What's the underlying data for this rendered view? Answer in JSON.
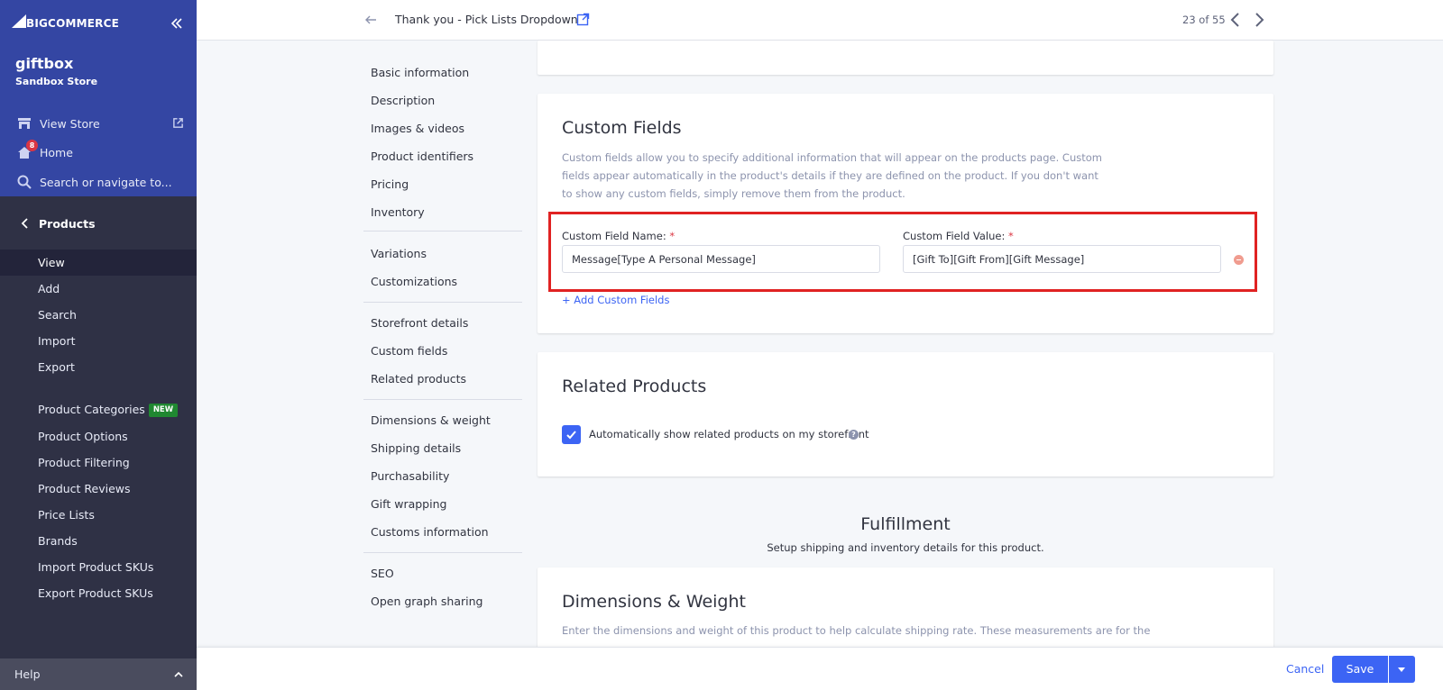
{
  "brand": {
    "logo_text": "BIGCOMMERCE",
    "store_name": "giftbox",
    "store_type": "Sandbox Store"
  },
  "sidebar": {
    "view_store": "View Store",
    "home": "Home",
    "home_badge": "8",
    "search_placeholder": "Search or navigate to...",
    "section": "Products",
    "items": [
      {
        "label": "View",
        "active": true
      },
      {
        "label": "Add"
      },
      {
        "label": "Search"
      },
      {
        "label": "Import"
      },
      {
        "label": "Export"
      }
    ],
    "items2": [
      {
        "label": "Product Categories",
        "badge": "NEW"
      },
      {
        "label": "Product Options"
      },
      {
        "label": "Product Filtering"
      },
      {
        "label": "Product Reviews"
      },
      {
        "label": "Price Lists"
      },
      {
        "label": "Brands"
      },
      {
        "label": "Import Product SKUs"
      },
      {
        "label": "Export Product SKUs"
      }
    ],
    "help": "Help"
  },
  "header": {
    "title": "Thank you - Pick Lists Dropdown",
    "pager": "23 of 55"
  },
  "section_nav": [
    "Basic information",
    "Description",
    "Images & videos",
    "Product identifiers",
    "Pricing",
    "Inventory",
    "Variations",
    "Customizations",
    "Storefront details",
    "Custom fields",
    "Related products",
    "Dimensions & weight",
    "Shipping details",
    "Purchasability",
    "Gift wrapping",
    "Customs information",
    "SEO",
    "Open graph sharing"
  ],
  "custom_fields": {
    "title": "Custom Fields",
    "description": "Custom fields allow you to specify additional information that will appear on the products page. Custom fields appear automatically in the product's details if they are defined on the product. If you don't want to show any custom fields, simply remove them from the product.",
    "name_label": "Custom Field Name:",
    "value_label": "Custom Field Value:",
    "required_mark": "*",
    "name_value": "Message[Type A Personal Message]",
    "value_value": "[Gift To][Gift From][Gift Message]",
    "add_link": "+ Add Custom Fields"
  },
  "related_products": {
    "title": "Related Products",
    "checkbox_label": "Automatically show related products on my storefront",
    "checked": true
  },
  "fulfillment": {
    "title": "Fulfillment",
    "subtitle": "Setup shipping and inventory details for this product."
  },
  "dimensions": {
    "title": "Dimensions & Weight",
    "description": "Enter the dimensions and weight of this product to help calculate shipping rate. These measurements are for the"
  },
  "footer": {
    "cancel": "Cancel",
    "save": "Save"
  },
  "colors": {
    "sidebar_top": "#3446a3",
    "sidebar": "#2f3145",
    "accent": "#3c64f4",
    "highlight": "#e02222"
  }
}
